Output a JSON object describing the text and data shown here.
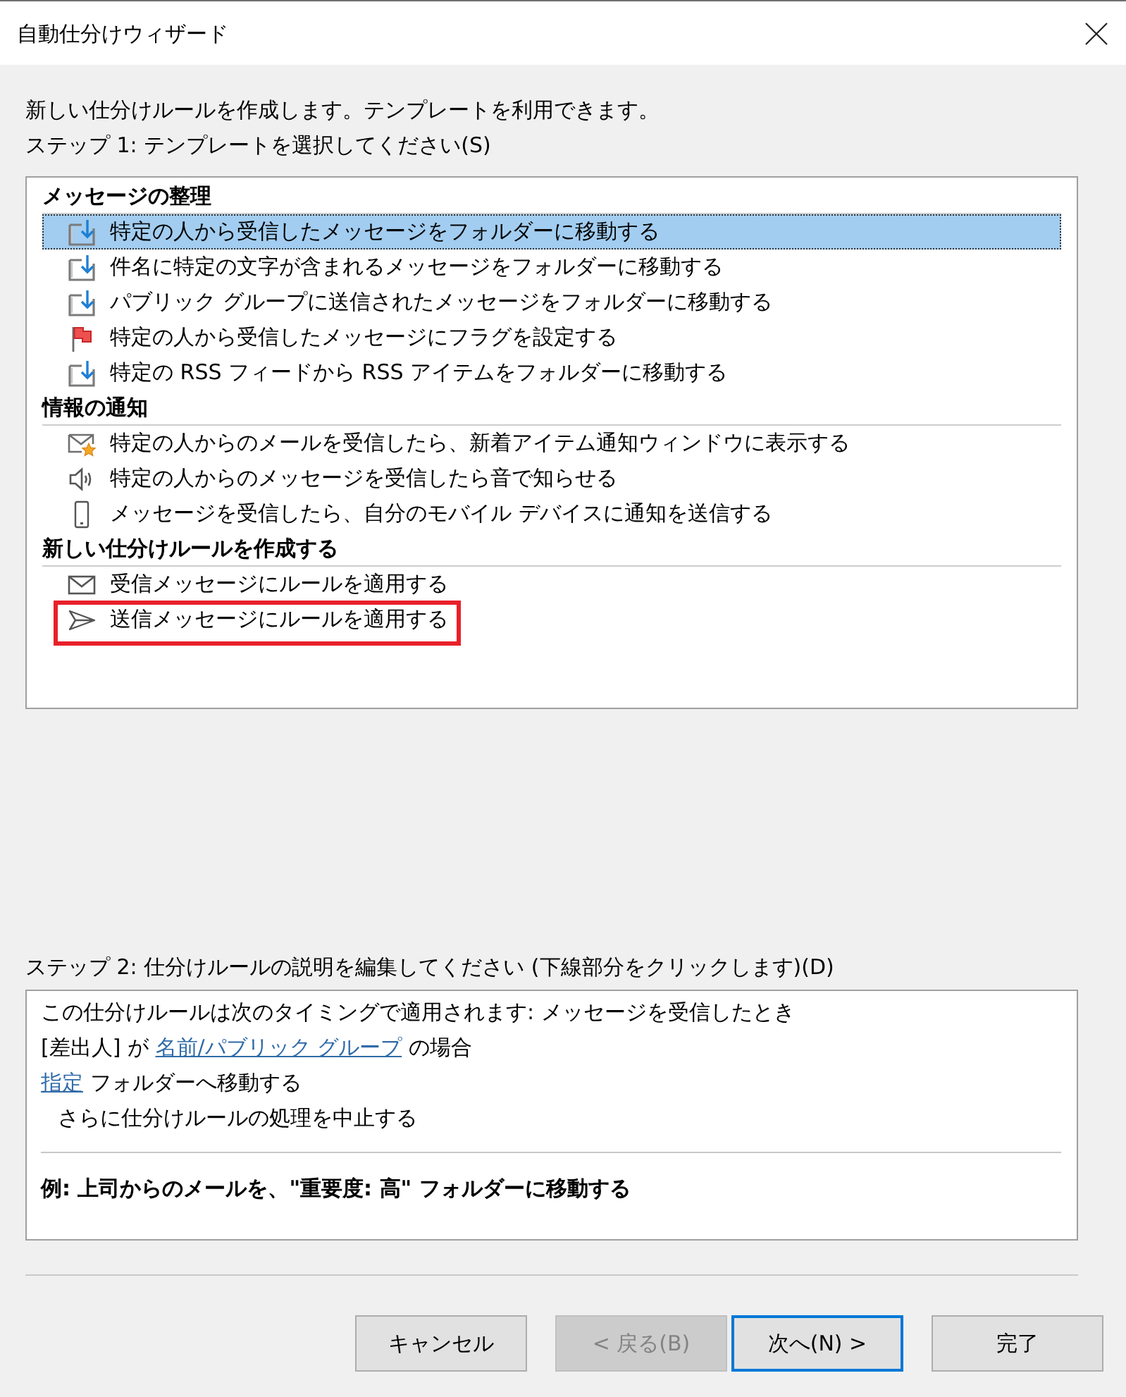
{
  "window": {
    "title": "自動仕分けウィザード"
  },
  "intro": "新しい仕分けルールを作成します。テンプレートを利用できます。",
  "step1": {
    "label": "ステップ 1: テンプレートを選択してください(S)",
    "groups": [
      {
        "title": "メッセージの整理",
        "items": [
          {
            "kind": "move",
            "label": "特定の人から受信したメッセージをフォルダーに移動する",
            "selected": true,
            "highlighted": false
          },
          {
            "kind": "move",
            "label": "件名に特定の文字が含まれるメッセージをフォルダーに移動する",
            "selected": false,
            "highlighted": false
          },
          {
            "kind": "move",
            "label": "パブリック グループに送信されたメッセージをフォルダーに移動する",
            "selected": false,
            "highlighted": false
          },
          {
            "kind": "flag",
            "label": "特定の人から受信したメッセージにフラグを設定する",
            "selected": false,
            "highlighted": false
          },
          {
            "kind": "move",
            "label": "特定の RSS フィードから RSS アイテムをフォルダーに移動する",
            "selected": false,
            "highlighted": false
          }
        ]
      },
      {
        "title": "情報の通知",
        "items": [
          {
            "kind": "alert",
            "label": "特定の人からのメールを受信したら、新着アイテム通知ウィンドウに表示する",
            "selected": false,
            "highlighted": false
          },
          {
            "kind": "sound",
            "label": "特定の人からのメッセージを受信したら音で知らせる",
            "selected": false,
            "highlighted": false
          },
          {
            "kind": "mobile",
            "label": "メッセージを受信したら、自分のモバイル デバイスに通知を送信する",
            "selected": false,
            "highlighted": false
          }
        ]
      },
      {
        "title": "新しい仕分けルールを作成する",
        "items": [
          {
            "kind": "inbox",
            "label": "受信メッセージにルールを適用する",
            "selected": false,
            "highlighted": false
          },
          {
            "kind": "send",
            "label": "送信メッセージにルールを適用する",
            "selected": false,
            "highlighted": true
          }
        ]
      }
    ]
  },
  "step2": {
    "label": "ステップ 2: 仕分けルールの説明を編集してください (下線部分をクリックします)(D)",
    "lines": [
      {
        "indented": false,
        "segments": [
          {
            "kind": "text",
            "text": "この仕分けルールは次のタイミングで適用されます: メッセージを受信したとき"
          }
        ]
      },
      {
        "indented": false,
        "segments": [
          {
            "kind": "text",
            "text": "[差出人] が"
          },
          {
            "kind": "link",
            "text": "名前/パブリック グループ"
          },
          {
            "kind": "text",
            "text": "の場合"
          }
        ]
      },
      {
        "indented": false,
        "segments": [
          {
            "kind": "link",
            "text": "指定"
          },
          {
            "kind": "text",
            "text": "フォルダーへ移動する"
          }
        ]
      },
      {
        "indented": true,
        "segments": [
          {
            "kind": "text",
            "text": "さらに仕分けルールの処理を中止する"
          }
        ]
      }
    ],
    "example": "例: 上司からのメールを、\"重要度: 高\" フォルダーに移動する"
  },
  "button_groups": [
    [
      {
        "label": "キャンセル",
        "disabled": false,
        "default": false
      }
    ],
    [
      {
        "label": "< 戻る(B)",
        "disabled": true,
        "default": false
      },
      {
        "label": "次へ(N) >",
        "disabled": false,
        "default": true
      }
    ],
    [
      {
        "label": "完了",
        "disabled": false,
        "default": false
      }
    ]
  ]
}
